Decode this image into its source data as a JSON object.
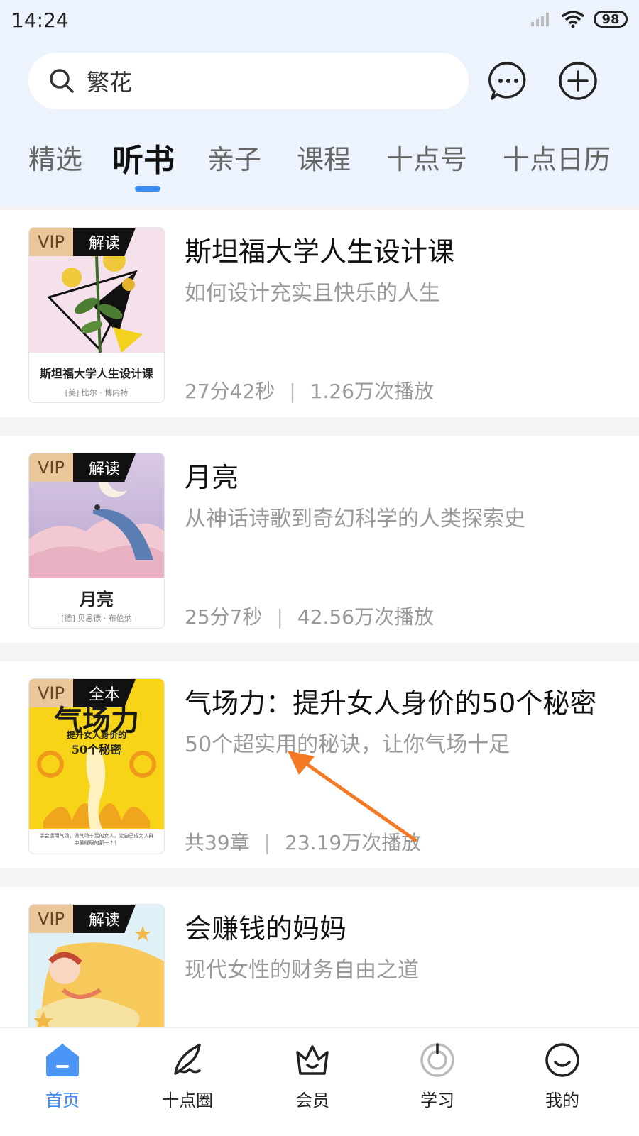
{
  "status_bar": {
    "time": "14:24",
    "battery": "98"
  },
  "search": {
    "value": "繁花"
  },
  "tabs": [
    {
      "label": "精选",
      "active": false
    },
    {
      "label": "听书",
      "active": true
    },
    {
      "label": "亲子",
      "active": false
    },
    {
      "label": "课程",
      "active": false
    },
    {
      "label": "十点号",
      "active": false
    },
    {
      "label": "十点日历",
      "active": false
    }
  ],
  "books": [
    {
      "badge_vip": "VIP",
      "badge_type": "解读",
      "title": "斯坦福大学人生设计课",
      "subtitle": "如何设计充实且快乐的人生",
      "duration": "27分42秒",
      "plays": "1.26万次播放",
      "cover_title": "斯坦福大学人生设计课",
      "cover_author": "[美] 比尔 · 博内特"
    },
    {
      "badge_vip": "VIP",
      "badge_type": "解读",
      "title": "月亮",
      "subtitle": "从神话诗歌到奇幻科学的人类探索史",
      "duration": "25分7秒",
      "plays": "42.56万次播放",
      "cover_title": "月亮",
      "cover_author": "[德] 贝恩德 · 布伦纳"
    },
    {
      "badge_vip": "VIP",
      "badge_type": "全本",
      "title": "气场力：提升女人身价的50个秘密",
      "subtitle": "50个超实用的秘诀，让你气场十足",
      "duration": "共39章",
      "plays": "23.19万次播放",
      "cover_title": "气场力",
      "cover_line1": "提升女人身价的",
      "cover_line2": "50个秘密",
      "cover_foot": "学会运用气场，做气场十足的女人，让自己成为人群中最耀眼的那一个！"
    },
    {
      "badge_vip": "VIP",
      "badge_type": "解读",
      "title": "会赚钱的妈妈",
      "subtitle": "现代女性的财务自由之道"
    }
  ],
  "bottom_nav": [
    {
      "label": "首页",
      "icon": "home-icon",
      "active": true
    },
    {
      "label": "十点圈",
      "icon": "feather-icon",
      "active": false
    },
    {
      "label": "会员",
      "icon": "crown-icon",
      "active": false
    },
    {
      "label": "学习",
      "icon": "study-icon",
      "active": false
    },
    {
      "label": "我的",
      "icon": "smile-icon",
      "active": false
    }
  ],
  "colors": {
    "accent": "#3b8df5",
    "header_bg": "#edf3fc",
    "vip_gold": "#e9c79a"
  }
}
